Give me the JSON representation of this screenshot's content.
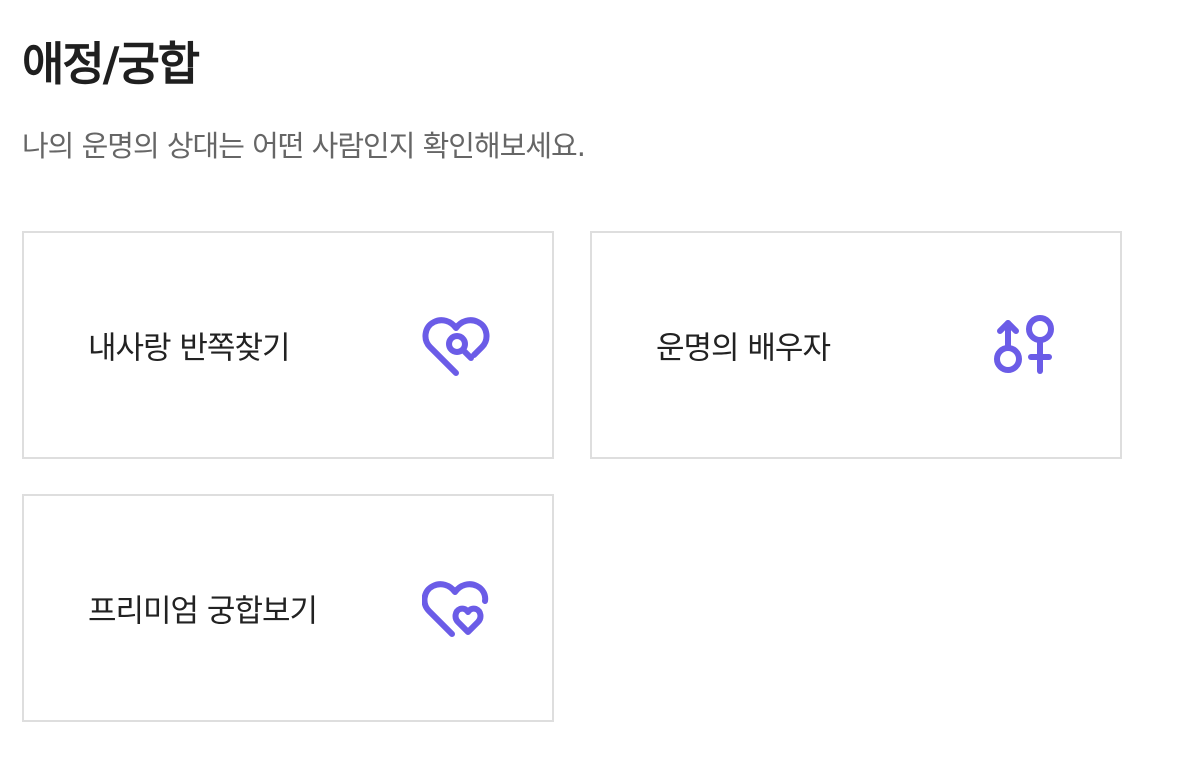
{
  "header": {
    "title": "애정/궁합",
    "subtitle": "나의 운명의 상대는 어떤 사람인지 확인해보세요."
  },
  "cards": [
    {
      "label": "내사랑 반쪽찾기",
      "icon": "heart-search-icon"
    },
    {
      "label": "운명의 배우자",
      "icon": "gender-symbols-icon"
    },
    {
      "label": "프리미엄 궁합보기",
      "icon": "double-heart-icon"
    }
  ],
  "colors": {
    "accent": "#6b5ce7",
    "title": "#1f1f1f",
    "subtitle": "#666666",
    "card_border": "#dedede"
  }
}
